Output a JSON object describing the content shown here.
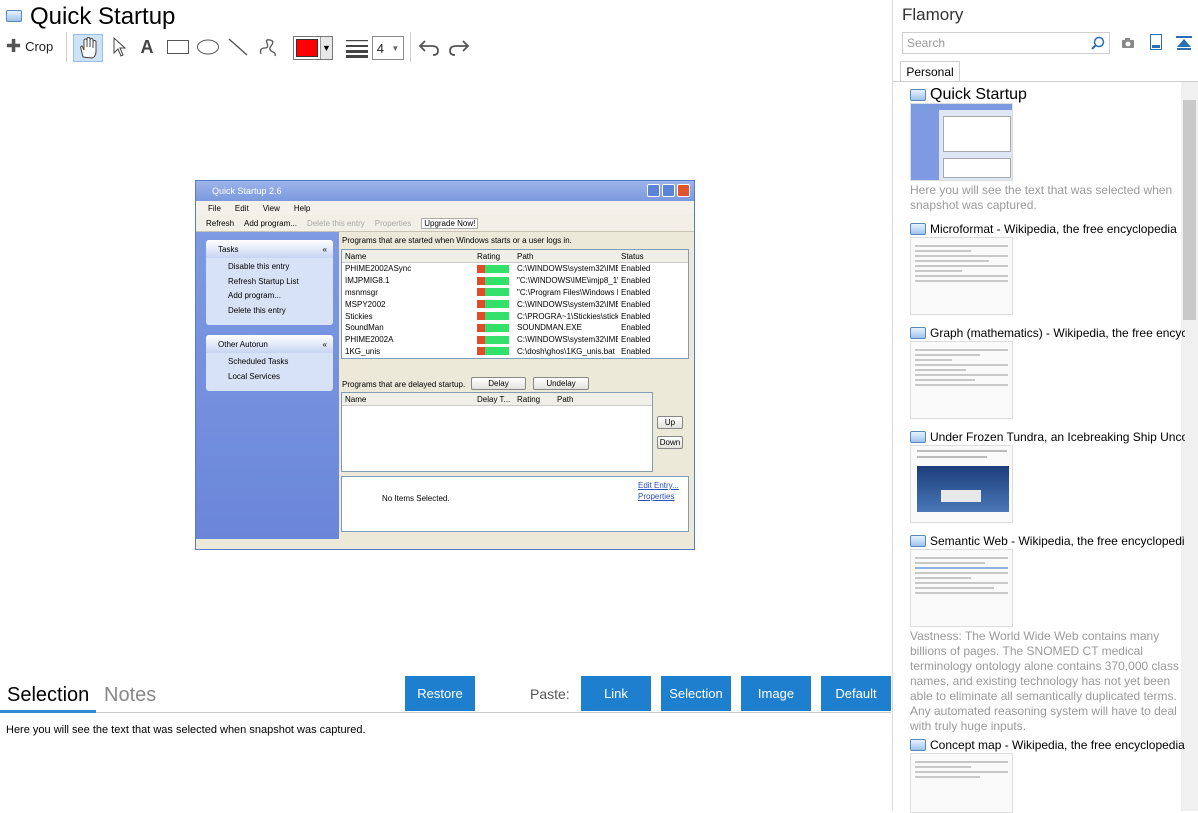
{
  "header": {
    "title": "Quick Startup"
  },
  "toolbar": {
    "crop_label": "Crop",
    "text_tool_glyph": "A",
    "icons": [
      "crop-icon",
      "hand-icon",
      "pointer-icon",
      "text-icon",
      "rectangle-icon",
      "ellipse-icon",
      "line-icon",
      "freehand-icon",
      "color-dropdown",
      "line-weight-icon",
      "undo-icon",
      "redo-icon"
    ],
    "color": "#ff0000",
    "line_width": "4"
  },
  "snapshot": {
    "window_title": "Quick Startup 2.6",
    "menu": [
      "File",
      "Edit",
      "View",
      "Help"
    ],
    "toolbar": [
      "Refresh",
      "Add program...",
      "Delete this entry",
      "Properties",
      "Upgrade Now!"
    ],
    "tasks_title": "Tasks",
    "tasks": [
      "Disable this entry",
      "Refresh Startup List",
      "Add program...",
      "Delete this entry"
    ],
    "other_title": "Other Autorun",
    "other": [
      "Scheduled Tasks",
      "Local Services"
    ],
    "programs_caption": "Programs that are started when Windows starts or a user logs in.",
    "columns": [
      "Name",
      "Rating",
      "Path",
      "Status"
    ],
    "rows": [
      {
        "name": "PHIME2002ASync",
        "path": "C:\\WINDOWS\\system32\\IME\\",
        "status": "Enabled"
      },
      {
        "name": "IMJPMIG8.1",
        "path": "\"C:\\WINDOWS\\IME\\imjp8_1\\I",
        "status": "Enabled"
      },
      {
        "name": "msnmsgr",
        "path": "\"C:\\Program Files\\Windows Liv",
        "status": "Enabled"
      },
      {
        "name": "MSPY2002",
        "path": "C:\\WINDOWS\\system32\\IME\\",
        "status": "Enabled"
      },
      {
        "name": "Stickies",
        "path": "C:\\PROGRA~1\\Stickies\\stickie",
        "status": "Enabled"
      },
      {
        "name": "SoundMan",
        "path": "SOUNDMAN.EXE",
        "status": "Enabled"
      },
      {
        "name": "PHIME2002A",
        "path": "C:\\WINDOWS\\system32\\IME\\",
        "status": "Enabled"
      },
      {
        "name": "1KG_unis",
        "path": "C:\\dosh\\ghos\\1KG_unis.bat",
        "status": "Enabled"
      }
    ],
    "delayed_caption": "Programs that are delayed startup.",
    "delay_btn": "Delay",
    "undelay_btn": "Undelay",
    "delayed_columns": [
      "Name",
      "Delay T...",
      "Rating",
      "Path"
    ],
    "up_btn": "Up",
    "down_btn": "Down",
    "no_items": "No Items Selected.",
    "edit_entry": "Edit Entry...",
    "properties": "Properties"
  },
  "bottom": {
    "tab_selection": "Selection",
    "tab_notes": "Notes",
    "restore": "Restore",
    "paste_label": "Paste:",
    "paste_link": "Link",
    "paste_selection": "Selection",
    "paste_image": "Image",
    "paste_default": "Default",
    "selected_text": "Here you will see the text that was selected when snapshot was captured."
  },
  "sidebar": {
    "brand": "Flamory",
    "search_placeholder": "Search",
    "tab": "Personal",
    "items": [
      {
        "title": "Quick Startup",
        "desc": "Here you will see the text that was selected when snapshot was captured."
      },
      {
        "title": "Microformat - Wikipedia, the free encyclopedia",
        "desc": ""
      },
      {
        "title": "Graph (mathematics) - Wikipedia, the free encyclopedia",
        "desc": ""
      },
      {
        "title": "Under Frozen Tundra, an Icebreaking Ship Uncovers",
        "desc": ""
      },
      {
        "title": "Semantic Web - Wikipedia, the free encyclopedia",
        "desc": "Vastness: The World Wide Web contains many billions of pages. The SNOMED CT medical terminology ontology alone contains 370,000 class names, and existing technology has not yet been able to eliminate all semantically duplicated terms. Any automated reasoning system will have to deal with truly huge inputs."
      },
      {
        "title": "Concept map - Wikipedia, the free encyclopedia",
        "desc": ""
      }
    ]
  }
}
